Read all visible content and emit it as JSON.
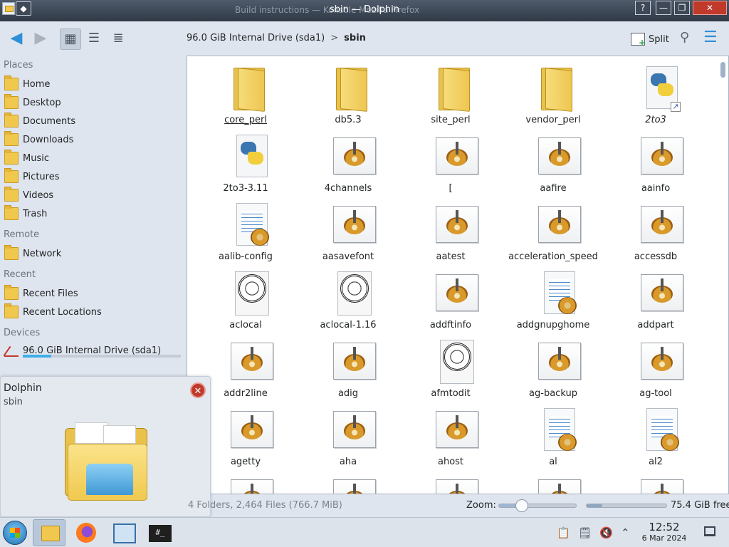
{
  "window": {
    "title": "sbin — Dolphin",
    "background_title": "Build instructions — Konsole Mozilla Firefox",
    "buttons": {
      "help": "?",
      "minimize": "—",
      "maximize": "❐",
      "close": "✕"
    }
  },
  "toolbar": {
    "back_icon": "arrow-left-icon",
    "forward_icon": "arrow-right-icon",
    "view_modes": [
      "icons",
      "compact",
      "details"
    ],
    "split_label": "Split"
  },
  "breadcrumb": {
    "drive": "96.0 GiB Internal Drive (sda1)",
    "separator": ">",
    "current": "sbin"
  },
  "sidebar": {
    "places_heading": "Places",
    "places": [
      {
        "label": "Home"
      },
      {
        "label": "Desktop"
      },
      {
        "label": "Documents"
      },
      {
        "label": "Downloads"
      },
      {
        "label": "Music"
      },
      {
        "label": "Pictures"
      },
      {
        "label": "Videos"
      },
      {
        "label": "Trash"
      }
    ],
    "remote_heading": "Remote",
    "remote": [
      {
        "label": "Network"
      }
    ],
    "recent_heading": "Recent",
    "recent": [
      {
        "label": "Recent Files"
      },
      {
        "label": "Recent Locations"
      }
    ],
    "devices_heading": "Devices",
    "devices": [
      {
        "label": "96.0 GiB Internal Drive (sda1)",
        "used_fraction": 0.18
      }
    ]
  },
  "notification": {
    "title": "Dolphin",
    "body": "sbin"
  },
  "files": [
    {
      "name": "core_perl",
      "kind": "folder"
    },
    {
      "name": "db5.3",
      "kind": "folder"
    },
    {
      "name": "site_perl",
      "kind": "folder"
    },
    {
      "name": "vendor_perl",
      "kind": "folder"
    },
    {
      "name": "2to3",
      "kind": "python-link"
    },
    {
      "name": "2to3-3.11",
      "kind": "python"
    },
    {
      "name": "4channels",
      "kind": "exe"
    },
    {
      "name": "[",
      "kind": "exe"
    },
    {
      "name": "aafire",
      "kind": "exe"
    },
    {
      "name": "aainfo",
      "kind": "exe"
    },
    {
      "name": "aalib-config",
      "kind": "script"
    },
    {
      "name": "aasavefont",
      "kind": "exe"
    },
    {
      "name": "aatest",
      "kind": "exe"
    },
    {
      "name": "acceleration_speed",
      "kind": "exe"
    },
    {
      "name": "accessdb",
      "kind": "exe"
    },
    {
      "name": "aclocal",
      "kind": "seal"
    },
    {
      "name": "aclocal-1.16",
      "kind": "seal"
    },
    {
      "name": "addftinfo",
      "kind": "exe"
    },
    {
      "name": "addgnupghome",
      "kind": "script"
    },
    {
      "name": "addpart",
      "kind": "exe"
    },
    {
      "name": "addr2line",
      "kind": "exe"
    },
    {
      "name": "adig",
      "kind": "exe"
    },
    {
      "name": "afmtodit",
      "kind": "seal"
    },
    {
      "name": "ag-backup",
      "kind": "exe"
    },
    {
      "name": "ag-tool",
      "kind": "exe"
    },
    {
      "name": "agetty",
      "kind": "exe"
    },
    {
      "name": "aha",
      "kind": "exe"
    },
    {
      "name": "ahost",
      "kind": "exe"
    },
    {
      "name": "al",
      "kind": "script"
    },
    {
      "name": "al2",
      "kind": "script"
    }
  ],
  "statusbar": {
    "summary": "4 Folders, 2,464 Files (766.7 MiB)",
    "zoom_label": "Zoom:",
    "zoom_fraction": 0.3,
    "free_label": "75.4 GiB free",
    "used_fraction": 0.2
  },
  "taskbar": {
    "apps": [
      "dolphin",
      "firefox",
      "konqueror",
      "konsole"
    ],
    "time": "12:52",
    "date": "6 Mar 2024"
  }
}
